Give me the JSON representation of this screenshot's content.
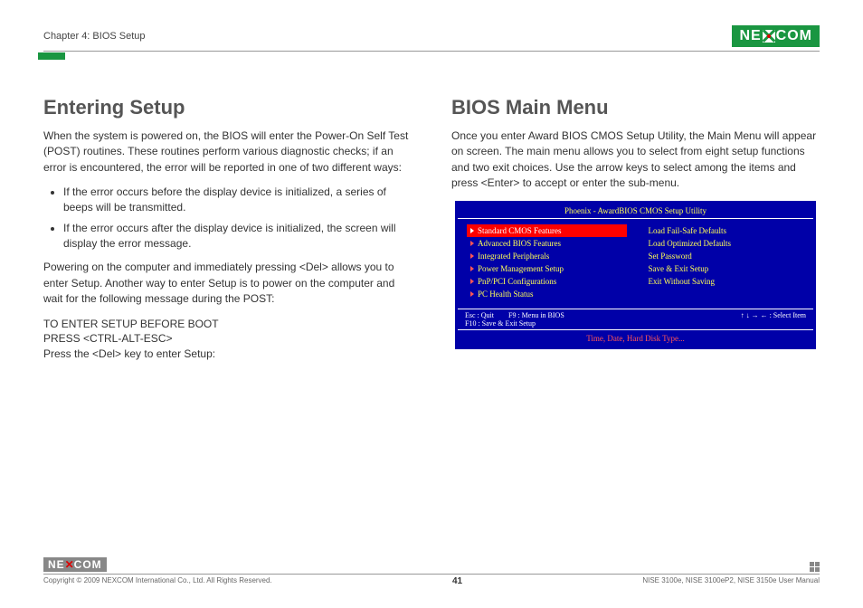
{
  "header": {
    "chapter": "Chapter 4: BIOS Setup",
    "logo_text_left": "NE",
    "logo_text_right": "COM"
  },
  "left": {
    "heading": "Entering Setup",
    "p1": "When the system is powered on, the BIOS will enter the Power-On Self Test (POST) routines. These routines perform various diagnostic checks; if an error is encountered, the error will be reported in one of two different ways:",
    "bullets": [
      "If the error occurs before the display device is initialized, a series of beeps will be transmitted.",
      "If the error occurs after the display device is initialized, the screen will display the error message."
    ],
    "p2": "Powering on the computer and immediately pressing <Del> allows you to enter Setup. Another way to enter Setup is to power on the computer and wait for the following message during the POST:",
    "lines": [
      "TO ENTER SETUP BEFORE BOOT",
      "PRESS <CTRL-ALT-ESC>",
      "Press the <Del> key to enter Setup:"
    ]
  },
  "right": {
    "heading": "BIOS Main Menu",
    "p1": "Once you enter Award BIOS CMOS Setup Utility, the Main Menu will appear on screen. The main menu allows you to select from eight setup functions and two exit choices. Use the arrow keys to select among the items and press <Enter> to accept or enter the sub-menu."
  },
  "bios": {
    "title": "Phoenix - AwardBIOS CMOS Setup Utility",
    "left_items": [
      "Standard CMOS Features",
      "Advanced BIOS Features",
      "Integrated Peripherals",
      "Power Management Setup",
      "PnP/PCI Configurations",
      "PC Health Status"
    ],
    "right_items": [
      "Load Fail-Safe Defaults",
      "Load Optimized Defaults",
      "Set Password",
      "Save & Exit Setup",
      "Exit Without Saving"
    ],
    "help_left_1": "Esc   :   Quit",
    "help_left_2": "F9   :   Menu in BIOS",
    "help_left_3": "F10   :   Save & Exit Setup",
    "help_right": "↑ ↓ → ←  : Select Item",
    "footer": "Time, Date, Hard Disk Type..."
  },
  "footer": {
    "copyright": "Copyright © 2009 NEXCOM International Co., Ltd. All Rights Reserved.",
    "page": "41",
    "manual": "NISE 3100e, NISE 3100eP2, NISE 3150e User Manual"
  }
}
